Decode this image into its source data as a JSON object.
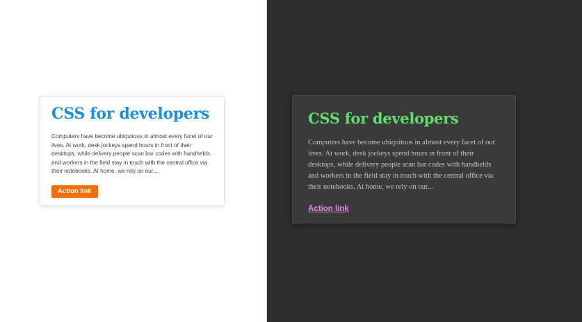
{
  "light_card": {
    "title": "CSS for developers",
    "body": "Computers have become ubiquitous in almost every facet of our lives. At work, desk jockeys spend hours in front of their desktops, while delivery people scan bar codes with handhelds and workers in the field stay in touch with the central office via their notebooks. At home, we rely on our....",
    "action_label": "Action link",
    "colors": {
      "title": "#1a8fe6",
      "button": "#f26d0c"
    }
  },
  "dark_card": {
    "title": "CSS for developers",
    "body": "Computers have become ubiquitous in almost every facet of our lives. At work, desk jockeys spend hours in front of their desktops, while delivery people scan bar codes with handhelds and workers in the field stay in touch with the central office via their notebooks. At home, we rely on our...",
    "action_label": "Action link",
    "colors": {
      "title": "#5fe06c",
      "link": "#e688e8",
      "background": "#2e2e2e"
    }
  }
}
